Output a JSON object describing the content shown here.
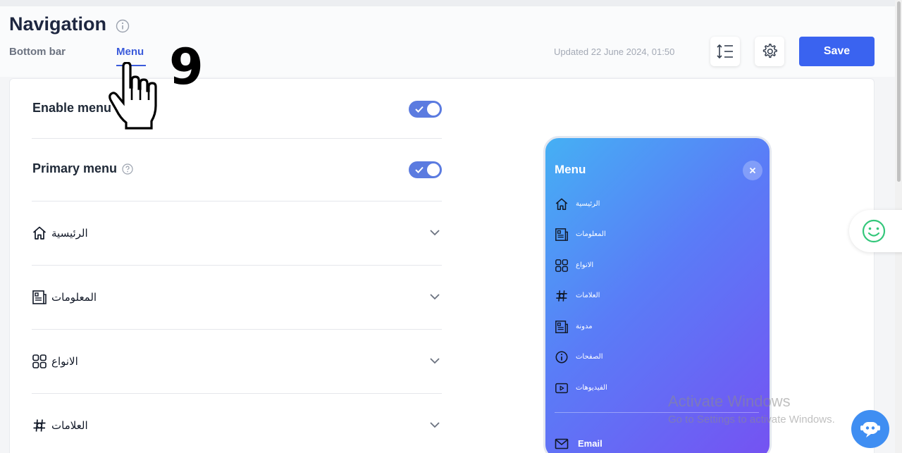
{
  "header": {
    "title": "Navigation",
    "tabs": [
      {
        "label": "Bottom bar",
        "active": false
      },
      {
        "label": "Menu",
        "active": true
      }
    ],
    "updated": "Updated 22 June 2024, 01:50",
    "save_label": "Save"
  },
  "settings": {
    "enable_menu": {
      "label": "Enable menu",
      "on": true
    },
    "primary_menu": {
      "label": "Primary menu",
      "on": true
    }
  },
  "menu_items": [
    {
      "label": "الرئيسية",
      "icon": "home-icon"
    },
    {
      "label": "المعلومات",
      "icon": "newspaper-icon"
    },
    {
      "label": "الانواع",
      "icon": "grid-icon"
    },
    {
      "label": "العلامات",
      "icon": "hashtag-icon"
    }
  ],
  "preview": {
    "title": "Menu",
    "items": [
      {
        "label": "الرئيسية",
        "icon": "home-icon"
      },
      {
        "label": "المعلومات",
        "icon": "newspaper-icon"
      },
      {
        "label": "الانواع",
        "icon": "grid-icon"
      },
      {
        "label": "العلامات",
        "icon": "hashtag-icon"
      },
      {
        "label": "مدونة",
        "icon": "newspaper-icon"
      },
      {
        "label": "الصفحات",
        "icon": "info-icon"
      },
      {
        "label": "الفيديوهات",
        "icon": "video-icon"
      }
    ],
    "email_label": "Email"
  },
  "overlay": {
    "watermark_line1": "Activate Windows",
    "watermark_line2": "Go to Settings to activate Windows.",
    "step_number": "9"
  },
  "colors": {
    "accent": "#3a63f0",
    "toggle": "#5b7be0",
    "tab_active": "#3b5bdb",
    "gradient_start": "#45b0f4",
    "gradient_end": "#7552f2"
  }
}
